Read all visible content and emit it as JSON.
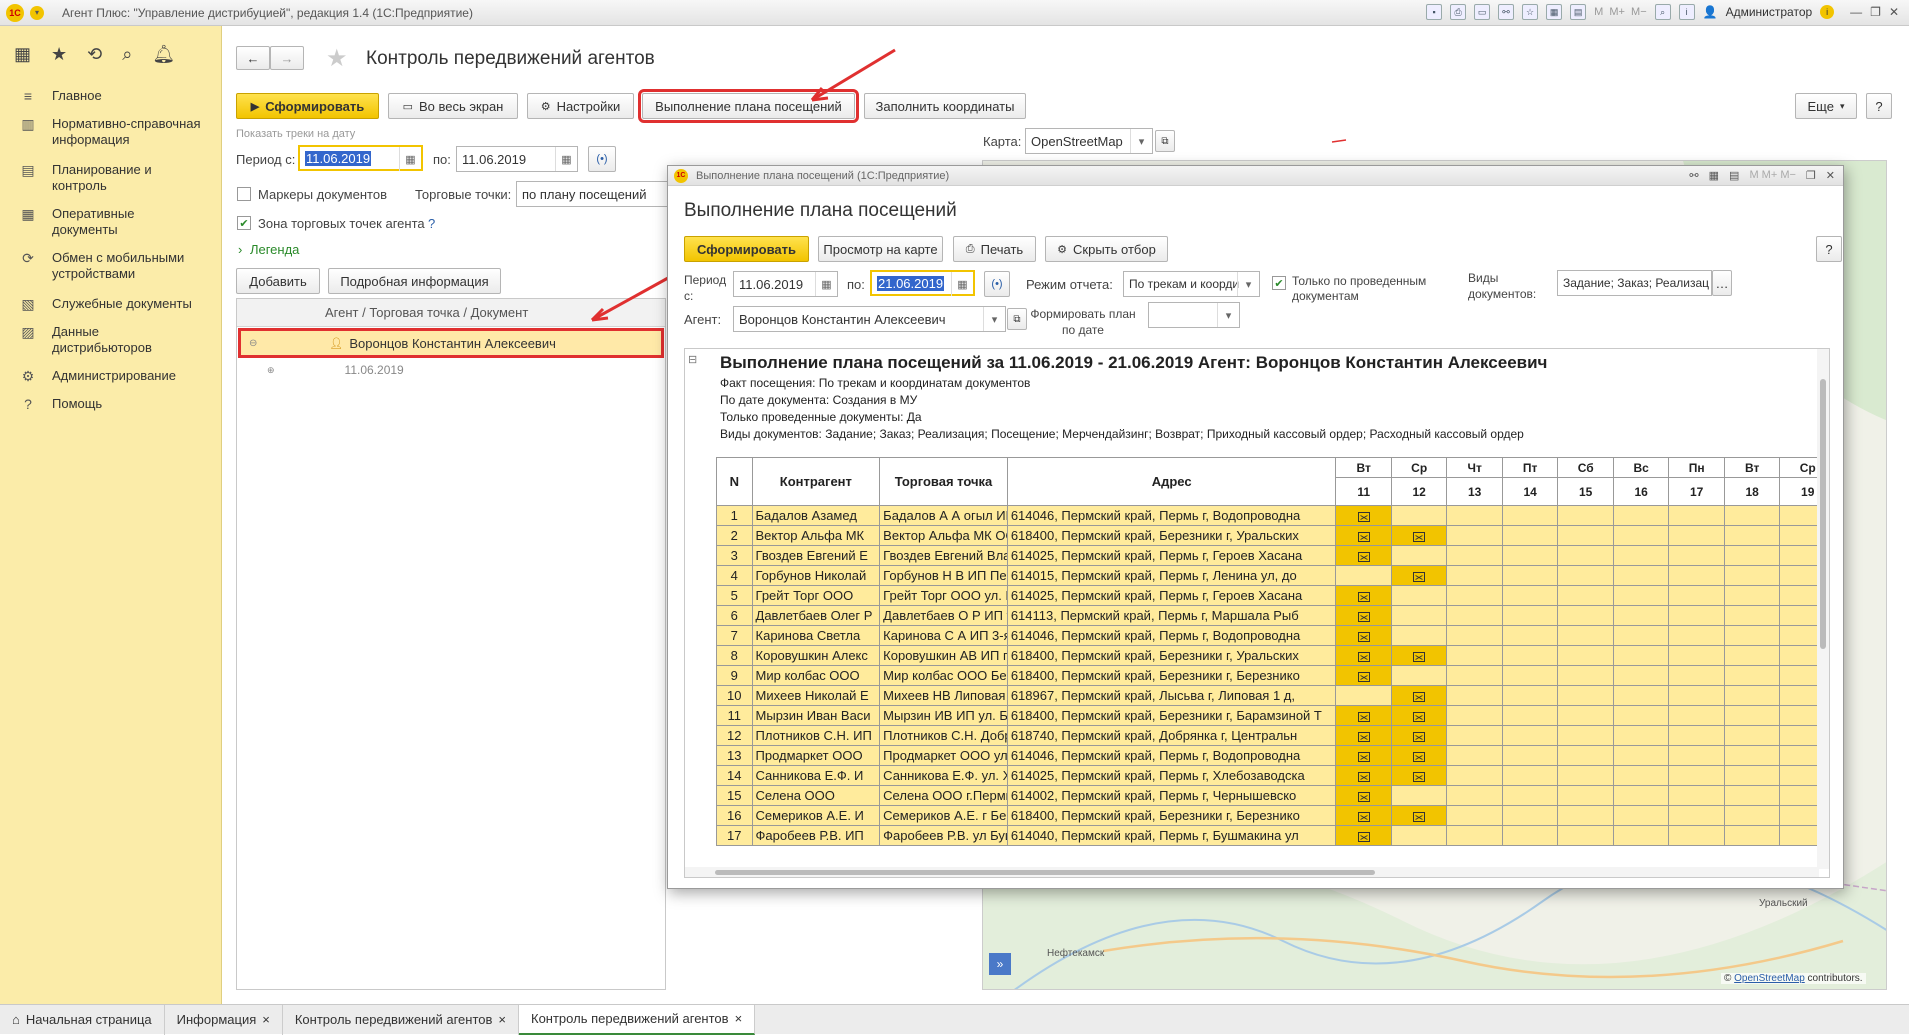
{
  "window": {
    "title": "Агент Плюс: \"Управление дистрибуцией\", редакция 1.4  (1С:Предприятие)",
    "user": "Администратор"
  },
  "sidebar": {
    "items": [
      {
        "label": "Главное",
        "icon": "menu-lines-icon"
      },
      {
        "label": "Нормативно-справочная информация",
        "icon": "catalog-icon"
      },
      {
        "label": "Планирование и контроль",
        "icon": "chart-icon"
      },
      {
        "label": "Оперативные документы",
        "icon": "document-icon"
      },
      {
        "label": "Обмен с мобильными устройствами",
        "icon": "sync-icon"
      },
      {
        "label": "Служебные документы",
        "icon": "service-doc-icon"
      },
      {
        "label": "Данные дистрибьюторов",
        "icon": "database-icon"
      },
      {
        "label": "Администрирование",
        "icon": "gear-icon"
      },
      {
        "label": "Помощь",
        "icon": "help-icon"
      }
    ]
  },
  "form": {
    "title": "Контроль передвижений агентов",
    "buttons": {
      "generate": "Сформировать",
      "fullscreen": "Во весь экран",
      "settings": "Настройки",
      "plan": "Выполнение плана посещений",
      "coords": "Заполнить координаты",
      "more": "Еще"
    },
    "show_tracks": "Показать треки на дату",
    "period_from_label": "Период с:",
    "period_from": "11.06.2019",
    "period_to_label": "по:",
    "period_to": "11.06.2019",
    "map_label": "Карта:",
    "map_value": "OpenStreetMap",
    "markers_label": "Маркеры документов",
    "trade_points_label": "Торговые точки:",
    "trade_points_value": "по плану посещений",
    "zone_label": "Зона торговых точек агента",
    "zone_help": "?",
    "legend": "Легенда",
    "add": "Добавить",
    "details": "Подробная информация",
    "tree_header": "Агент / Торговая точка / Документ",
    "tree_agent": "Воронцов Константин Алексеевич",
    "tree_date": "11.06.2019"
  },
  "map": {
    "cities": [
      "Уральский",
      "Нефтекамск"
    ],
    "attribution_link": "OpenStreetMap",
    "attribution_rest": " contributors."
  },
  "popup": {
    "window_title": "Выполнение плана посещений  (1С:Предприятие)",
    "title": "Выполнение плана посещений",
    "buttons": {
      "generate": "Сформировать",
      "map": "Просмотр на карте",
      "print": "Печать",
      "hide_filter": "Скрыть отбор",
      "help": "?"
    },
    "period_label": "Период с:",
    "period_from": "11.06.2019",
    "period_to_label": "по:",
    "period_to": "21.06.2019",
    "mode_label": "Режим отчета:",
    "mode_value": "По трекам и коорди",
    "only_posted": "Только по проведенным документам",
    "doc_types_label": "Виды документов:",
    "doc_types_value": "Задание; Заказ; Реализац",
    "agent_label": "Агент:",
    "agent_value": "Воронцов Константин Алексеевич",
    "plan_by_date_label": "Формировать план по дате",
    "report": {
      "heading": "Выполнение плана посещений за 11.06.2019 - 21.06.2019   Агент: Воронцов Константин Алексеевич",
      "meta": [
        "Факт посещения: По трекам и координатам документов",
        "По дате документа: Создания в МУ",
        "Только проведенные документы: Да",
        "Виды документов: Задание; Заказ; Реализация; Посещение; Мерчендайзинг; Возврат; Приходный кассовый ордер; Расходный кассовый ордер"
      ],
      "columns": {
        "n": "N",
        "counterparty": "Контрагент",
        "trade_point": "Торговая точка",
        "address": "Адрес"
      },
      "days": [
        {
          "dow": "Вт",
          "d": "11"
        },
        {
          "dow": "Ср",
          "d": "12"
        },
        {
          "dow": "Чт",
          "d": "13"
        },
        {
          "dow": "Пт",
          "d": "14"
        },
        {
          "dow": "Сб",
          "d": "15"
        },
        {
          "dow": "Вс",
          "d": "16"
        },
        {
          "dow": "Пн",
          "d": "17"
        },
        {
          "dow": "Вт",
          "d": "18"
        },
        {
          "dow": "Ср",
          "d": "19"
        }
      ],
      "rows": [
        {
          "n": "1",
          "c": "Бадалов Азамед",
          "t": "Бадалов А А огыл ИП",
          "a": "614046, Пермский край, Пермь г, Водопроводна",
          "d11": "x",
          "d12": ""
        },
        {
          "n": "2",
          "c": "Вектор Альфа МК",
          "t": "Вектор Альфа МК ООО",
          "a": "618400, Пермский край, Березники г, Уральских",
          "d11": "x",
          "d12": "x"
        },
        {
          "n": "3",
          "c": "Гвоздев Евгений Е",
          "t": "Гвоздев Евгений Влад",
          "a": "614025, Пермский край, Пермь г, Героев Хасана",
          "d11": "x",
          "d12": ""
        },
        {
          "n": "4",
          "c": "Горбунов Николай",
          "t": "Горбунов Н В ИП Перм",
          "a": "614015, Пермский край, Пермь г, Ленина ул, до",
          "d11": "",
          "d12": "x"
        },
        {
          "n": "5",
          "c": "Грейт Торг ООО",
          "t": "Грейт Торг ООО ул. Г.",
          "a": "614025, Пермский край, Пермь г, Героев Хасана",
          "d11": "x",
          "d12": ""
        },
        {
          "n": "6",
          "c": "Давлетбаев Олег Р",
          "t": "Давлетбаев О Р ИП ул",
          "a": "614113, Пермский край, Пермь г, Маршала Рыб",
          "d11": "x",
          "d12": ""
        },
        {
          "n": "7",
          "c": "Каринова Светла",
          "t": "Каринова С А ИП 3-я",
          "a": "614046, Пермский край, Пермь г, Водопроводна",
          "d11": "x",
          "d12": ""
        },
        {
          "n": "8",
          "c": "Коровушкин Алекс",
          "t": "Коровушкин АВ ИП г.",
          "a": "618400, Пермский край, Березники г, Уральских",
          "d11": "x",
          "d12": "x"
        },
        {
          "n": "9",
          "c": "Мир колбас ООО",
          "t": "Мир колбас ООО Бере",
          "a": "618400, Пермский край, Березники г, Березнико",
          "d11": "x",
          "d12": ""
        },
        {
          "n": "10",
          "c": "Михеев Николай Е",
          "t": "Михеев НВ Липовая ул",
          "a": "618967, Пермский край, Лысьва г, Липовая 1 д,",
          "d11": "",
          "d12": "x"
        },
        {
          "n": "11",
          "c": "Мырзин Иван Васи",
          "t": "Мырзин ИВ ИП ул. Бар",
          "a": "618400, Пермский край, Березники г, Барамзиной Т",
          "d11": "x",
          "d12": "x"
        },
        {
          "n": "12",
          "c": "Плотников С.Н. ИП",
          "t": "Плотников С.Н. Добрян",
          "a": "618740, Пермский край, Добрянка г, Центральн",
          "d11": "x",
          "d12": "x"
        },
        {
          "n": "13",
          "c": "Продмаркет ООО",
          "t": "Продмаркет ООО ул. З",
          "a": "614046, Пермский край, Пермь г, Водопроводна",
          "d11": "x",
          "d12": "x"
        },
        {
          "n": "14",
          "c": "Санникова Е.Ф. И",
          "t": "Санникова Е.Ф. ул. Хл",
          "a": "614025, Пермский край, Пермь г, Хлебозаводска",
          "d11": "x",
          "d12": "x"
        },
        {
          "n": "15",
          "c": "Селена ООО",
          "t": "Селена ООО  г.Пермь,",
          "a": "614002, Пермский край, Пермь г, Чернышевско",
          "d11": "x",
          "d12": ""
        },
        {
          "n": "16",
          "c": "Семериков А.Е. И",
          "t": "Семериков А.Е. г Бере",
          "a": "618400, Пермский край, Березники г, Березнико",
          "d11": "x",
          "d12": "x"
        },
        {
          "n": "17",
          "c": "Фаробеев Р.В. ИП",
          "t": "Фаробеев Р.В. ул Буш",
          "a": "614040, Пермский край, Пермь г, Бушмакина ул",
          "d11": "x",
          "d12": ""
        }
      ]
    }
  },
  "tabs": [
    {
      "label": "Начальная страница",
      "close": false
    },
    {
      "label": "Информация",
      "close": true
    },
    {
      "label": "Контроль передвижений агентов",
      "close": true
    },
    {
      "label": "Контроль передвижений агентов",
      "close": true
    }
  ],
  "colors": {
    "accent_yellow": "#f2c400",
    "sidebar": "#fbeca9",
    "highlight_red": "#e03030"
  }
}
